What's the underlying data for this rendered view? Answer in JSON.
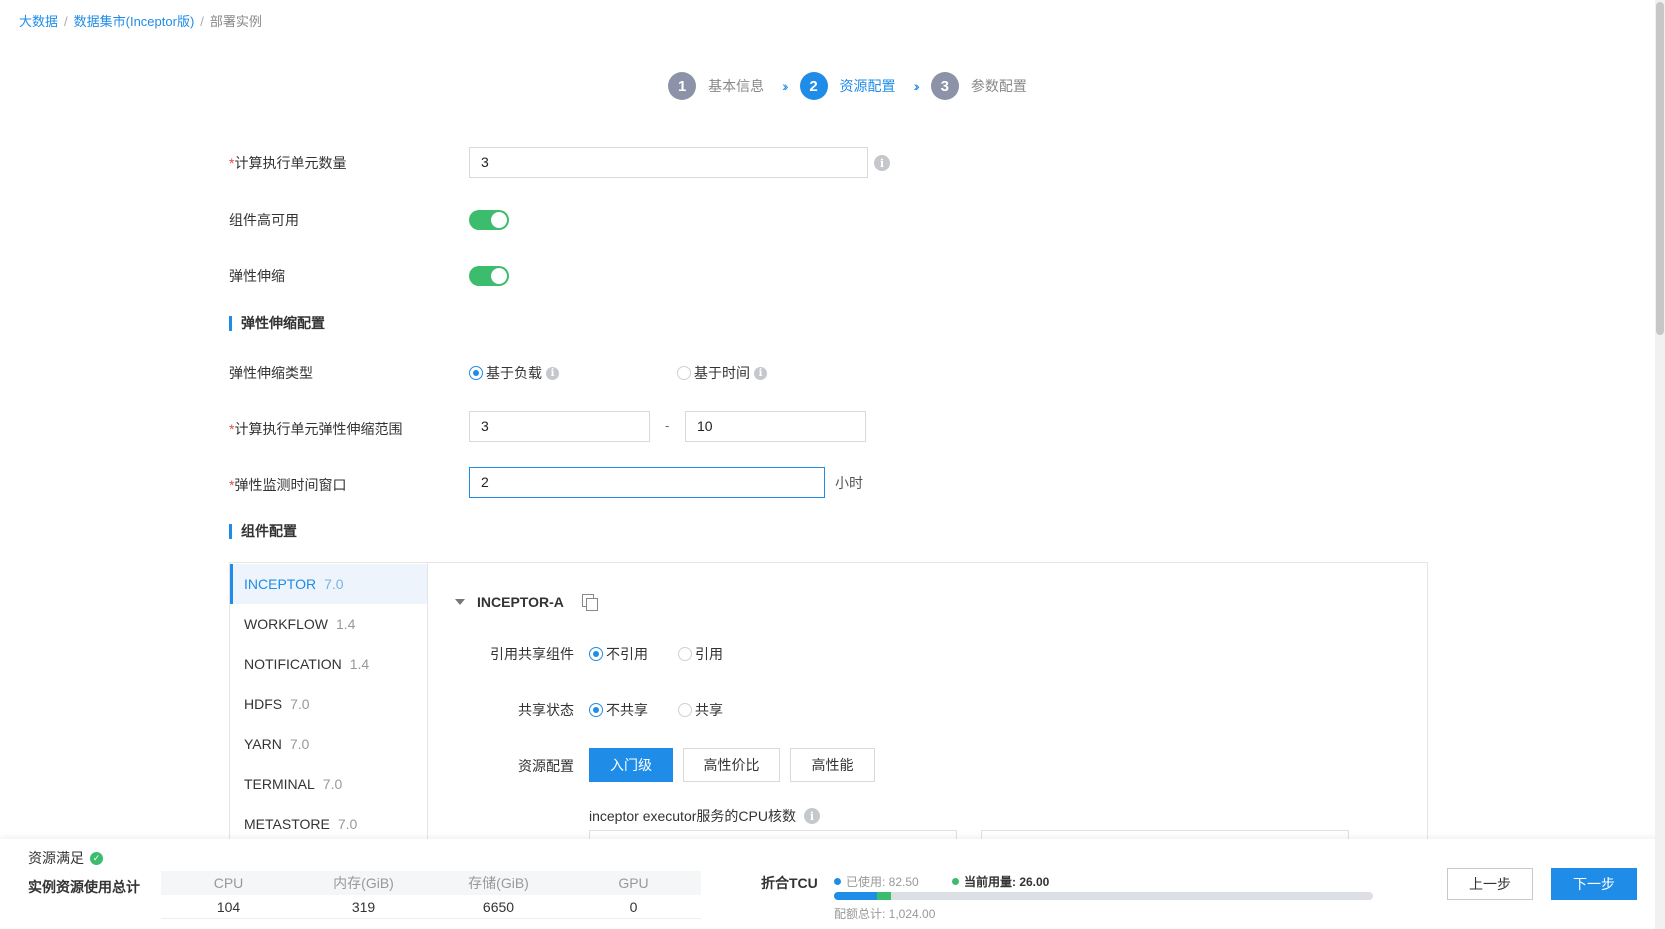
{
  "breadcrumb": {
    "items": [
      "大数据",
      "数据集市(Inceptor版)",
      "部署实例"
    ]
  },
  "steps": [
    {
      "num": "1",
      "label": "基本信息"
    },
    {
      "num": "2",
      "label": "资源配置"
    },
    {
      "num": "3",
      "label": "参数配置"
    }
  ],
  "form": {
    "compute_units": {
      "label": "计算执行单元数量",
      "required": "*",
      "value": "3"
    },
    "ha": {
      "label": "组件高可用",
      "enabled": true
    },
    "elastic": {
      "label": "弹性伸缩",
      "enabled": true
    },
    "elastic_section": "弹性伸缩配置",
    "elastic_type": {
      "label": "弹性伸缩类型",
      "options": [
        "基于负载",
        "基于时间"
      ],
      "selected": "基于负载"
    },
    "range": {
      "label": "计算执行单元弹性伸缩范围",
      "required": "*",
      "min": "3",
      "max": "10",
      "sep": "-"
    },
    "window": {
      "label": "弹性监测时间窗口",
      "required": "*",
      "value": "2",
      "unit": "小时"
    },
    "component_section": "组件配置"
  },
  "components": {
    "list": [
      {
        "name": "INCEPTOR",
        "version": "7.0"
      },
      {
        "name": "WORKFLOW",
        "version": "1.4"
      },
      {
        "name": "NOTIFICATION",
        "version": "1.4"
      },
      {
        "name": "HDFS",
        "version": "7.0"
      },
      {
        "name": "YARN",
        "version": "7.0"
      },
      {
        "name": "TERMINAL",
        "version": "7.0"
      },
      {
        "name": "METASTORE",
        "version": "7.0"
      }
    ],
    "selected": "INCEPTOR",
    "detail": {
      "title": "INCEPTOR-A",
      "ref_shared": {
        "label": "引用共享组件",
        "options": [
          "不引用",
          "引用"
        ],
        "selected": "不引用"
      },
      "share_state": {
        "label": "共享状态",
        "options": [
          "不共享",
          "共享"
        ],
        "selected": "不共享"
      },
      "resource": {
        "label": "资源配置",
        "tiers": [
          "入门级",
          "高性价比",
          "高性能"
        ],
        "selected": "入门级"
      },
      "cpu_label": "inceptor executor服务的CPU核数"
    }
  },
  "bottom": {
    "status": "资源满足",
    "total_label": "实例资源使用总计",
    "table": {
      "headers": [
        "CPU",
        "内存(GiB)",
        "存储(GiB)",
        "GPU"
      ],
      "values": [
        "104",
        "319",
        "6650",
        "0"
      ]
    },
    "tcu": {
      "label": "折合TCU",
      "used_label": "已使用: 82.50",
      "current_label": "当前用量: 26.00",
      "total_label": "配额总计: 1,024.00",
      "used": 82.5,
      "current": 26.0,
      "total": 1024.0
    },
    "prev_label": "上一步",
    "next_label": "下一步"
  },
  "colors": {
    "primary": "#1f8ce8",
    "success": "#3bbd6d"
  }
}
